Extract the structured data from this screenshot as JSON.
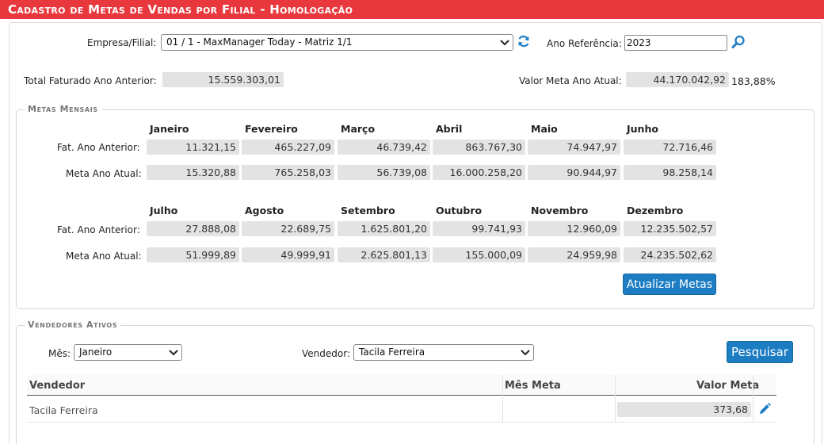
{
  "header": {
    "title": "Cadastro de Metas de Vendas por Filial  - Homologação"
  },
  "filters": {
    "empresa_label": "Empresa/Filial:",
    "empresa_value": "01 / 1 - MaxManager Today - Matriz 1/1",
    "ano_label": "Ano Referência:",
    "ano_value": "2023"
  },
  "summary": {
    "total_label": "Total Faturado Ano Anterior:",
    "total_value": "15.559.303,01",
    "meta_label": "Valor Meta Ano Atual:",
    "meta_value": "44.170.042,92",
    "meta_percent": "183,88%"
  },
  "metas": {
    "legend": "Metas Mensais",
    "fat_label": "Fat. Ano Anterior:",
    "meta_label": "Meta Ano Atual:",
    "months": [
      {
        "name": "Janeiro",
        "fat": "11.321,15",
        "meta": "15.320,88"
      },
      {
        "name": "Fevereiro",
        "fat": "465.227,09",
        "meta": "765.258,03"
      },
      {
        "name": "Março",
        "fat": "46.739,42",
        "meta": "56.739,08"
      },
      {
        "name": "Abril",
        "fat": "863.767,30",
        "meta": "16.000.258,20"
      },
      {
        "name": "Maio",
        "fat": "74.947,97",
        "meta": "90.944,97"
      },
      {
        "name": "Junho",
        "fat": "72.716,46",
        "meta": "98.258,14"
      },
      {
        "name": "Julho",
        "fat": "27.888,08",
        "meta": "51.999,89"
      },
      {
        "name": "Agosto",
        "fat": "22.689,75",
        "meta": "49.999,91"
      },
      {
        "name": "Setembro",
        "fat": "1.625.801,20",
        "meta": "2.625.801,13"
      },
      {
        "name": "Outubro",
        "fat": "99.741,93",
        "meta": "155.000,09"
      },
      {
        "name": "Novembro",
        "fat": "12.960,09",
        "meta": "24.959,98"
      },
      {
        "name": "Dezembro",
        "fat": "12.235.502,57",
        "meta": "24.235.502,62"
      }
    ],
    "update_button": "Atualizar Metas"
  },
  "vendedores": {
    "legend": "Vendedores Ativos",
    "mes_label": "Mês:",
    "mes_value": "Janeiro",
    "vendedor_label": "Vendedor:",
    "vendedor_value": "Tacila Ferreira",
    "search_button": "Pesquisar",
    "columns": [
      "Vendedor",
      "Mês Meta",
      "Valor Meta"
    ],
    "rows": [
      {
        "vendedor": "Tacila Ferreira",
        "mes_meta": "",
        "valor_meta": "373,68"
      }
    ]
  },
  "icons": {
    "refresh": "refresh-icon",
    "search": "search-icon",
    "edit": "pencil-icon"
  },
  "colors": {
    "title_bar": "#e8383d",
    "button": "#1c7dc3",
    "readonly": "#e3e3e3"
  }
}
